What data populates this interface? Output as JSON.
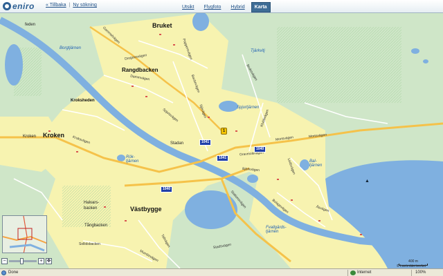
{
  "brand": {
    "logo_text": "eniro"
  },
  "topbar": {
    "back_label": "« Tillbaka",
    "separator": "|",
    "new_search_label": "Ny sökning",
    "tabs": [
      {
        "label": "Utsikt",
        "active": false
      },
      {
        "label": "Flygfoto",
        "active": false
      },
      {
        "label": "Hybrid",
        "active": false
      },
      {
        "label": "Karta",
        "active": true
      }
    ]
  },
  "map": {
    "places": {
      "bruket": "Bruket",
      "rangdbacken": "Rangdbacken",
      "kroksheden": "Kroksheden",
      "kroken": "Kroken",
      "kroken_small": "Kroken",
      "stadan": "Stadan",
      "vastbygge": "Västbygge",
      "halvars": "Halvars-",
      "halvars2": "backen",
      "tangbacken": "Tångbacken",
      "feden": "feden",
      "sollidsbacken": "Sollidsbacken"
    },
    "water": {
      "borgtjarnen": "Borgtjärnen",
      "tjarkvitj": "Tjärkvitj",
      "spjurtjarnen": "Spjurtjärnen",
      "rok_tjarnen": "Rök-\ntjärnen",
      "bal_tjarnen": "Bal-\ntjärnen",
      "fvallsjarnen": "Fvallgärds-\ntjärnen"
    },
    "roads": {
      "r1": "Drogonsvägen",
      "r2": "Pappersvägen",
      "r3": "Dammvägen",
      "r4": "Spjutsvägen",
      "r5": "Mortsvägen",
      "r6": "Gravmolsvägen",
      "r7": "Björkvägen",
      "r8": "Bruksvägen",
      "r9": "Backevägen",
      "r10": "Sjövägen",
      "r11": "Klubbvägen",
      "r12": "Ledsvägen",
      "r13": "Mortsvägen",
      "r14": "Stationsvägen",
      "r15": "Stadsvägen",
      "r16": "Tallvägen",
      "r17": "Kroksvägen",
      "r18": "Mumbsvägen",
      "r19": "Bolagsvägen",
      "r20": "Åsvägen",
      "r21": "Gammelvägen"
    },
    "shields": [
      "1041",
      "1041",
      "1040",
      "1040"
    ],
    "marker_label": "1",
    "scale_label": "400 m",
    "copyright": "© Lantmäteriverket"
  },
  "statusbar": {
    "left": "Done",
    "zone": "Internet",
    "zoom": "100%"
  },
  "colors": {
    "land": "#cfe6c8",
    "urban": "#f7f3b0",
    "water": "#7fb0e0",
    "road_major": "#f5c24a",
    "road_minor": "#ffffff",
    "accent": "#3f6d96"
  }
}
